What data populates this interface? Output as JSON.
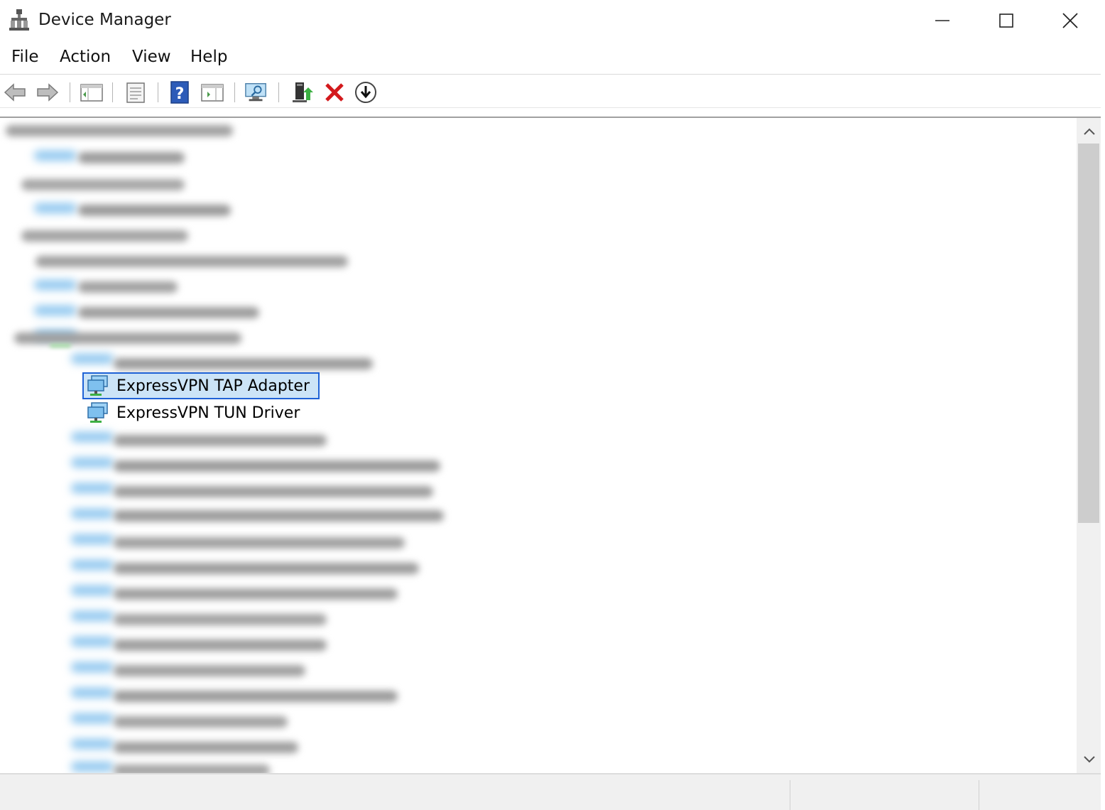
{
  "window": {
    "title": "Device Manager",
    "controls": [
      "minimize",
      "maximize",
      "close"
    ]
  },
  "menubar": {
    "items": [
      {
        "label": "File"
      },
      {
        "label": "Action"
      },
      {
        "label": "View"
      },
      {
        "label": "Help"
      }
    ]
  },
  "toolbar": {
    "buttons": [
      {
        "icon": "back-arrow-icon"
      },
      {
        "icon": "forward-arrow-icon"
      },
      {
        "icon": "show-hide-console-tree-icon"
      },
      {
        "icon": "properties-icon"
      },
      {
        "icon": "help-icon"
      },
      {
        "icon": "show-action-pane-icon"
      },
      {
        "icon": "scan-hardware-changes-icon"
      },
      {
        "icon": "update-driver-icon"
      },
      {
        "icon": "uninstall-device-icon"
      },
      {
        "icon": "enable-device-icon"
      }
    ]
  },
  "tree": {
    "visible_items": [
      {
        "label": "ExpressVPN TAP Adapter",
        "selected": true,
        "icon": "network-adapter-icon"
      },
      {
        "label": "ExpressVPN TUN Driver",
        "selected": false,
        "icon": "network-adapter-icon"
      }
    ]
  },
  "colors": {
    "selection_border": "#1f62d6",
    "selection_fill": "#cce4f7",
    "blur_icon": "#8fc7ef"
  }
}
